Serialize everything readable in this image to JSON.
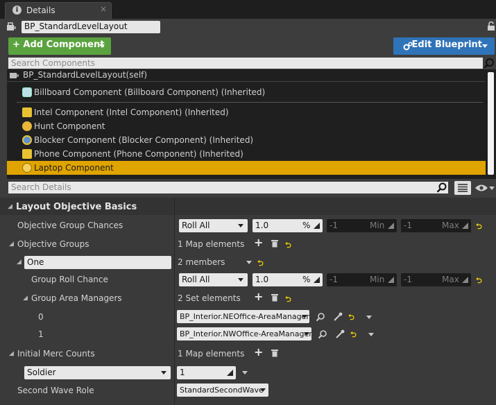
{
  "tab": {
    "title": "Details",
    "close": "×"
  },
  "header": {
    "blueprint_name": "BP_StandardLevelLayout",
    "add_component_label": "+ Add Component",
    "edit_blueprint_label": "Edit Blueprint",
    "search_components_placeholder": "Search Components",
    "search_details_placeholder": "Search Details"
  },
  "components": {
    "self": "BP_StandardLevelLayout(self)",
    "items": [
      "Billboard Component (Billboard Component) (Inherited)",
      "Intel Component (Intel Component) (Inherited)",
      "Hunt Component",
      "Blocker Component (Blocker Component) (Inherited)",
      "Phone Component (Phone Component) (Inherited)",
      "Laptop Component"
    ],
    "selected_index": 5
  },
  "details": {
    "category": "Layout Objective Basics",
    "objective_group_chances": {
      "label": "Objective Group Chances",
      "mode": "Roll All",
      "value": "1.0",
      "value_unit": "%",
      "min_value": "-1",
      "min_label": "Min",
      "max_value": "-1",
      "max_label": "Max"
    },
    "objective_groups": {
      "label": "Objective Groups",
      "summary": "1 Map elements",
      "key": "One",
      "key_summary": "2 members",
      "group_roll_chance": {
        "label": "Group Roll Chance",
        "mode": "Roll All",
        "value": "1.0",
        "value_unit": "%",
        "min_value": "-1",
        "min_label": "Min",
        "max_value": "-1",
        "max_label": "Max"
      },
      "group_area_managers": {
        "label": "Group Area Managers",
        "summary": "2 Set elements",
        "entries": [
          {
            "index": "0",
            "value": "BP_Interior.NEOffice-AreaManager"
          },
          {
            "index": "1",
            "value": "BP_Interior.NWOffice-AreaManager"
          }
        ]
      }
    },
    "initial_merc_counts": {
      "label": "Initial Merc Counts",
      "summary": "1 Map elements",
      "key": "Soldier",
      "value": "1"
    },
    "second_wave_role": {
      "label": "Second Wave Role",
      "value": "StandardSecondWave"
    }
  },
  "colors": {
    "add_button": "#5aa33f",
    "edit_button": "#2f73b8",
    "selected_row": "#e0a400",
    "reset_arrow": "#f0d000"
  }
}
